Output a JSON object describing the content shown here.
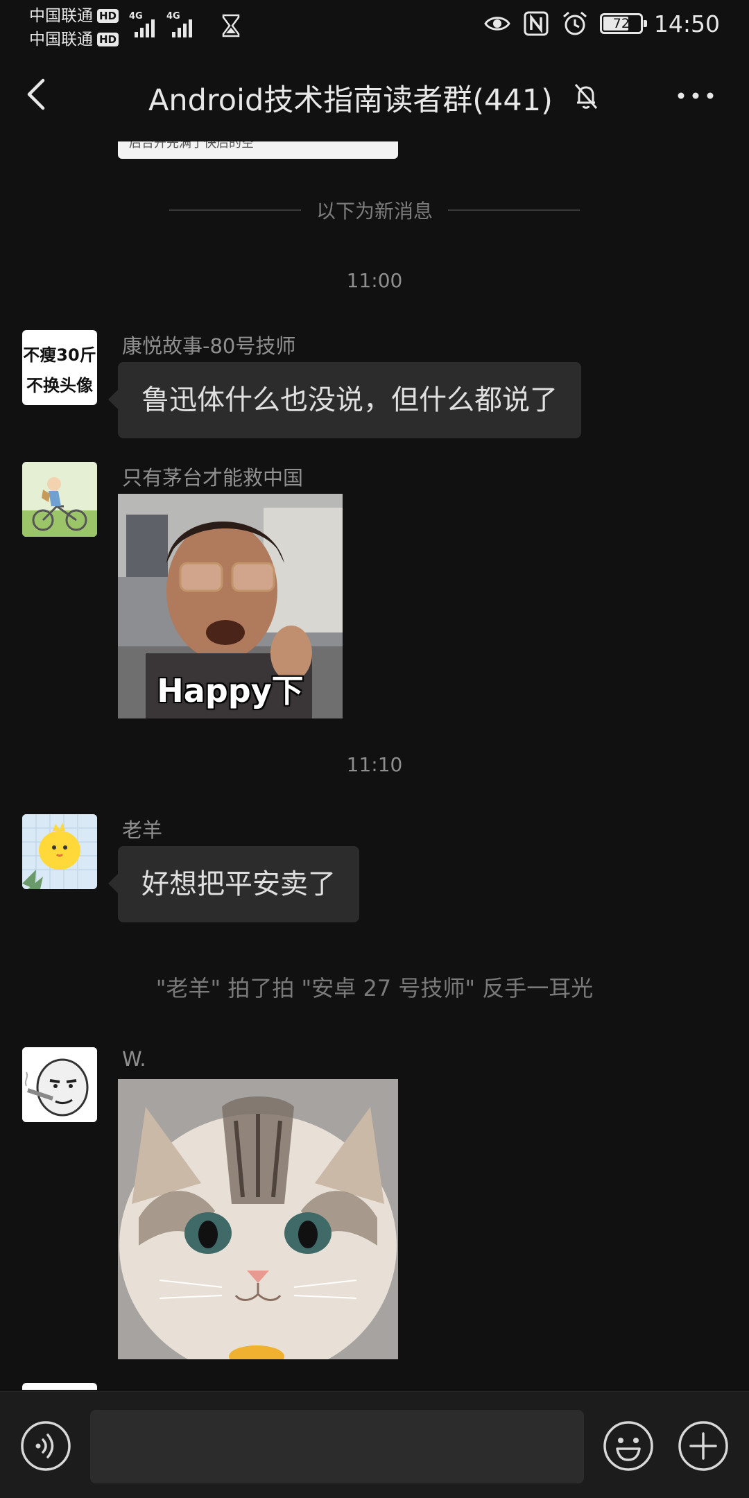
{
  "status_bar": {
    "carrier_1": "中国联通",
    "carrier_2": "中国联通",
    "hd_badge": "HD",
    "network_1": "4G",
    "network_2": "4G",
    "battery": "72",
    "battery_level_percent": 72,
    "time": "14:50",
    "icons": [
      "eye-icon",
      "nfc-icon",
      "alarm-icon",
      "hourglass-icon"
    ]
  },
  "header": {
    "title": "Android技术指南读者群(441)",
    "icons": [
      "back-arrow-icon",
      "muted-bell-icon",
      "more-dots-icon"
    ]
  },
  "messages": {
    "partial_card_text": "后台开先满了快后的空",
    "new_messages_divider": "以下为新消息",
    "time_1": "11:00",
    "time_2": "11:10",
    "items": [
      {
        "sender": "康悦故事-80号技师",
        "avatar_text_1": "不瘦30斤",
        "avatar_text_2": "不换头像",
        "text": "鲁迅体什么也没说，但什么都说了"
      },
      {
        "sender": "只有茅台才能救中国",
        "image_caption": "Happy下"
      },
      {
        "sender": "老羊",
        "text": "好想把平安卖了"
      },
      {
        "sender": "W."
      }
    ],
    "system_notice": "\"老羊\" 拍了拍 \"安卓 27 号技师\" 反手一耳光"
  },
  "input_bar": {
    "value": "",
    "icons": [
      "voice-icon",
      "emoji-icon",
      "plus-icon"
    ]
  },
  "colors": {
    "background": "#111111",
    "bubble": "#2c2c2c",
    "text_primary": "#e0e0e0",
    "text_secondary": "#909090"
  }
}
